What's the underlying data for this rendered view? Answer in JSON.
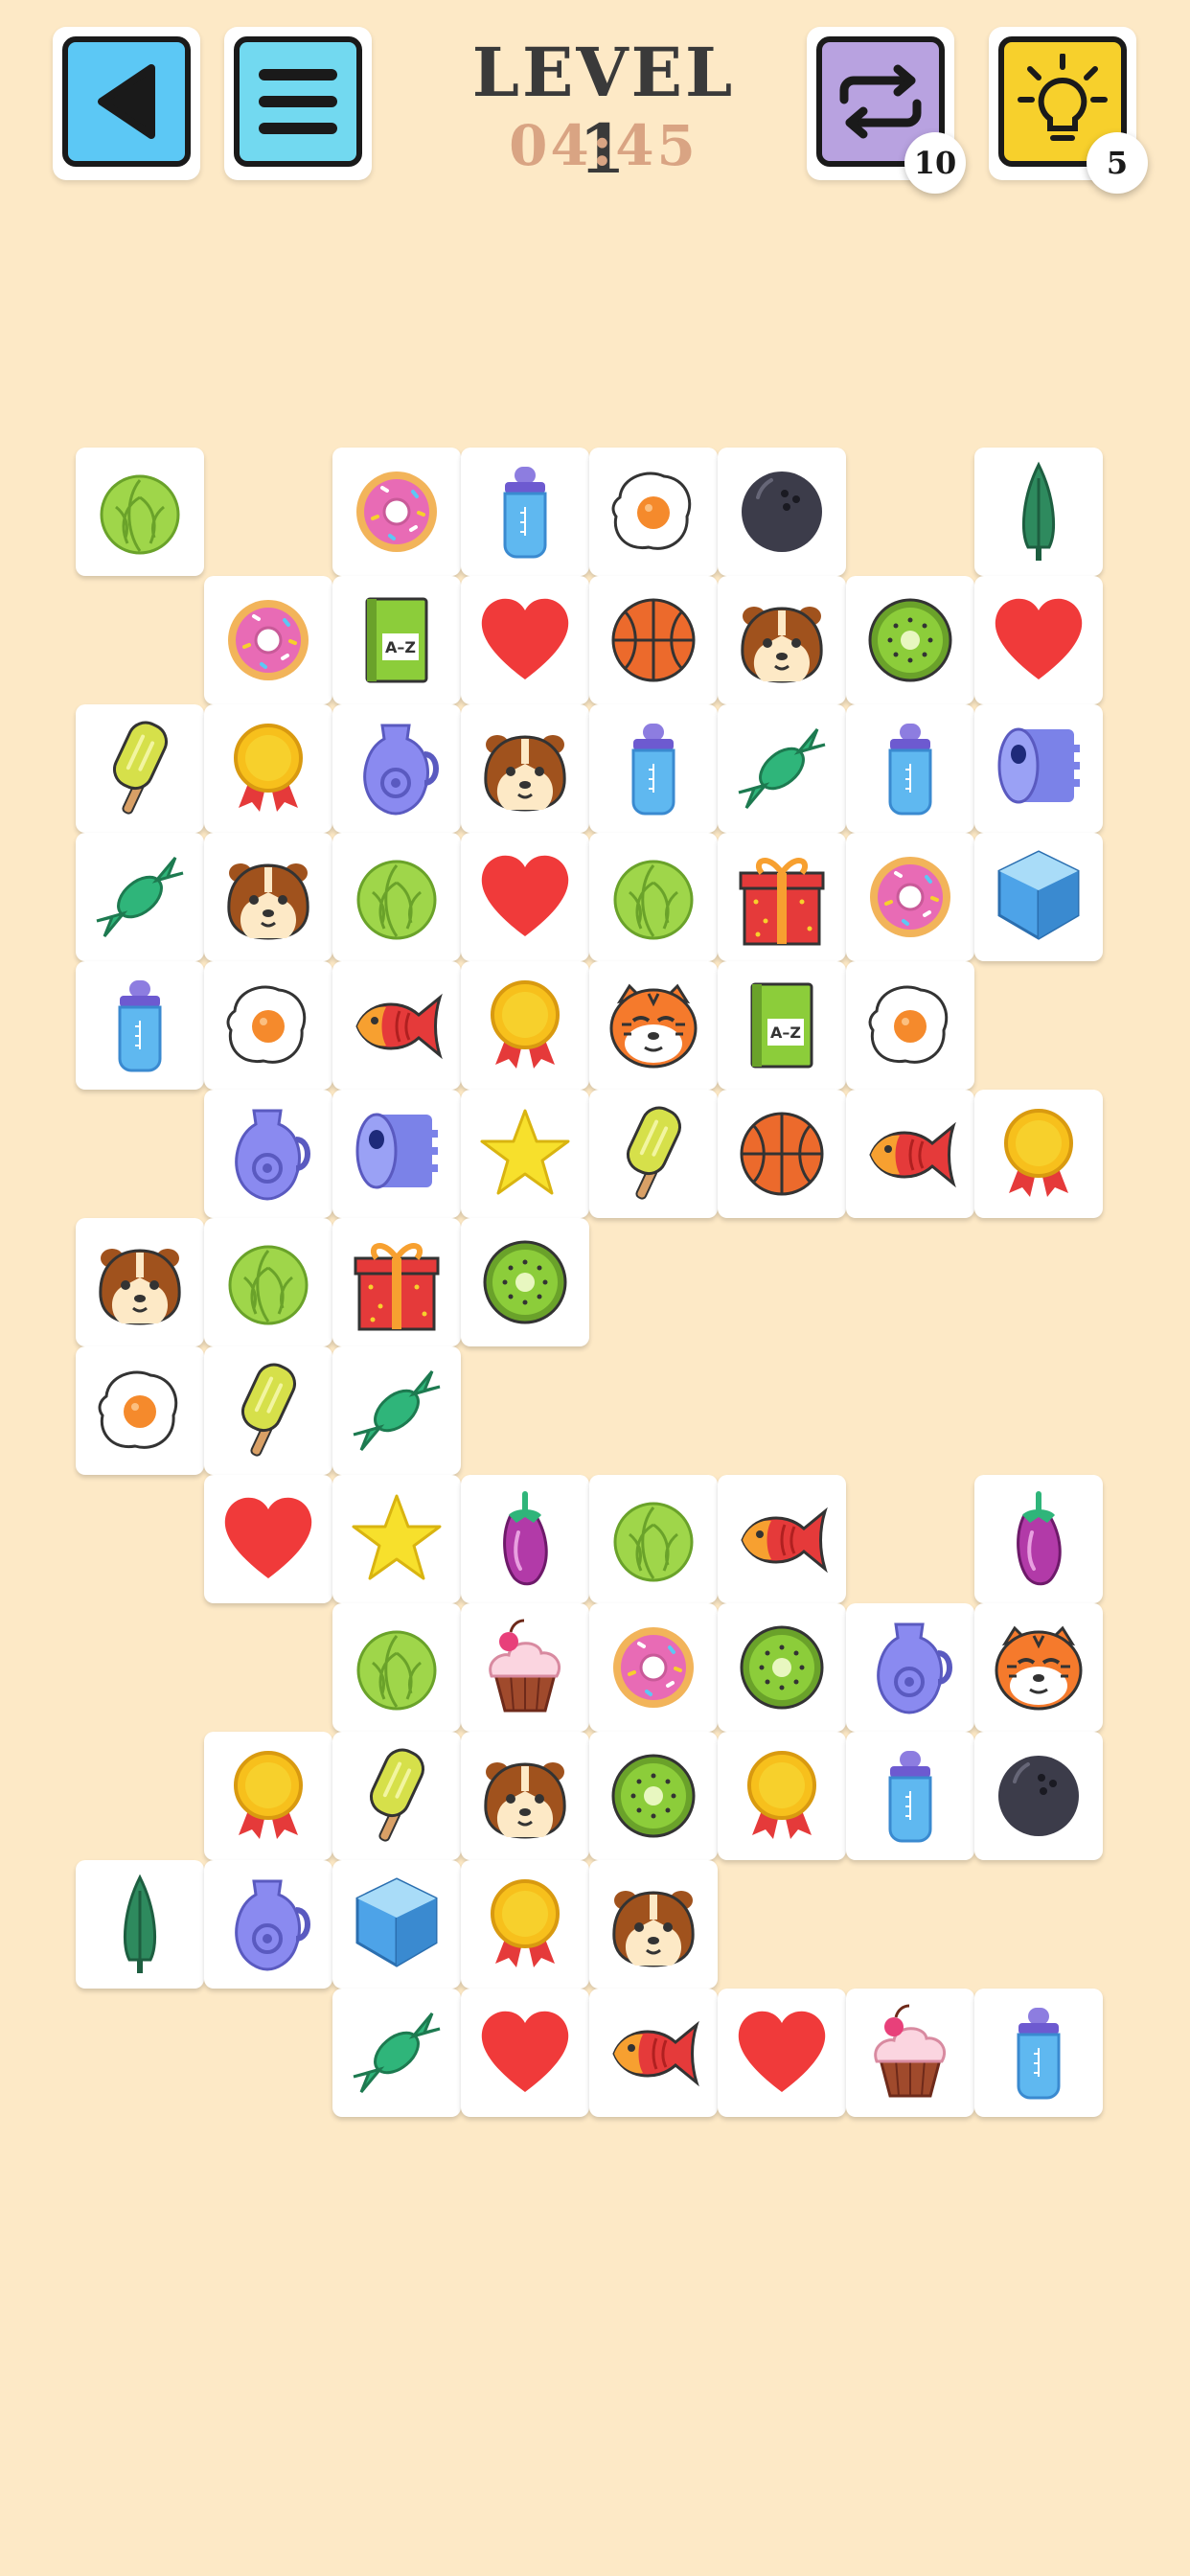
{
  "header": {
    "level_title": "LEVEL 1",
    "timer": "04:45",
    "back_icon": "play-back-icon",
    "menu_icon": "hamburger-menu-icon",
    "shuffle_icon": "shuffle-arrows-icon",
    "shuffle_count": "10",
    "hint_icon": "lightbulb-icon",
    "hint_count": "5",
    "colors": {
      "back": "#5cc8f5",
      "menu": "#72d9f0",
      "shuffle": "#b8a2e0",
      "hint": "#f7d02c",
      "title": "#3a3a3a",
      "timer": "#d9a483"
    }
  },
  "board": {
    "columns": 8,
    "rows": [
      [
        "cabbage",
        null,
        "donut",
        "baby-bottle",
        "fried-egg",
        "bowling-ball",
        null,
        "cypress-tree"
      ],
      [
        null,
        "donut",
        "dictionary-book",
        "heart",
        "basketball",
        "hamster",
        "kiwi",
        "heart"
      ],
      [
        "popsicle",
        "medal",
        "jug",
        "hamster",
        "baby-bottle",
        "candy",
        "baby-bottle",
        "paper-towel"
      ],
      [
        "candy",
        "hamster",
        "cabbage",
        "heart",
        "cabbage",
        "gift-box",
        "donut",
        "ice-cube"
      ],
      [
        "baby-bottle",
        "fried-egg",
        "fish",
        "medal",
        "tiger",
        "dictionary-book",
        "fried-egg",
        null
      ],
      [
        null,
        "jug",
        "paper-towel",
        "star",
        "popsicle",
        "basketball",
        "fish",
        "medal"
      ],
      [
        "hamster",
        "cabbage",
        "gift-box",
        "kiwi",
        null,
        null,
        null,
        null
      ],
      [
        "fried-egg",
        "popsicle",
        "candy",
        null,
        null,
        null,
        null,
        null
      ],
      [
        null,
        "heart",
        "star",
        "eggplant",
        "cabbage",
        "fish",
        null,
        "eggplant"
      ],
      [
        null,
        null,
        "cabbage",
        "cupcake",
        "donut",
        "kiwi",
        "jug",
        "tiger"
      ],
      [
        null,
        "medal",
        "popsicle",
        "hamster",
        "kiwi",
        "medal",
        "baby-bottle",
        "bowling-ball"
      ],
      [
        "cypress-tree",
        "jug",
        "ice-cube",
        "medal",
        "hamster",
        null,
        null,
        null
      ],
      [
        null,
        null,
        "candy",
        "heart",
        "fish",
        "heart",
        "cupcake",
        "baby-bottle"
      ]
    ],
    "book_text": "A–Z"
  }
}
